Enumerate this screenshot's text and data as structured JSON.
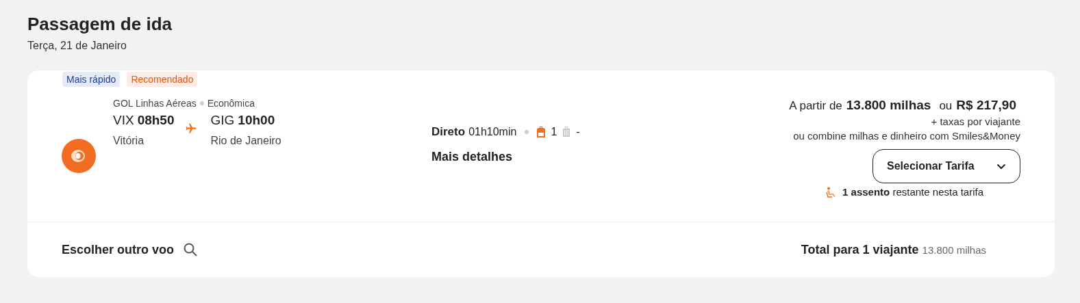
{
  "header": {
    "title": "Passagem de ida",
    "date": "Terça, 21 de Janeiro"
  },
  "badges": [
    {
      "label": "Mais rápido",
      "color": "#1f3c9c"
    },
    {
      "label": "Recomendado",
      "color": "#e5560f"
    }
  ],
  "flight": {
    "airline": "GOL Linhas Aéreas",
    "cabin": "Econômica",
    "origin_code": "VIX",
    "origin_time": "08h50",
    "origin_city": "Vitória",
    "dest_code": "GIG",
    "dest_time": "10h00",
    "dest_city": "Rio de Janeiro",
    "stops": "Direto",
    "duration": "01h10min",
    "carry_on": "1",
    "checked_bag": "-",
    "details_link": "Mais detalhes"
  },
  "price": {
    "prefix": "A partir de",
    "miles": "13.800 milhas",
    "or": "ou",
    "money": "R$ 217,90",
    "taxes": "+ taxas por viajante",
    "combine": "ou combine milhas e dinheiro com Smiles&Money",
    "select_button": "Selecionar Tarifa",
    "seats_bold": "1 assento",
    "seats_rest": "restante nesta tarifa"
  },
  "footer": {
    "other_flight": "Escolher outro voo",
    "total_label": "Total para 1 viajante",
    "total_value": "13.800 milhas"
  }
}
